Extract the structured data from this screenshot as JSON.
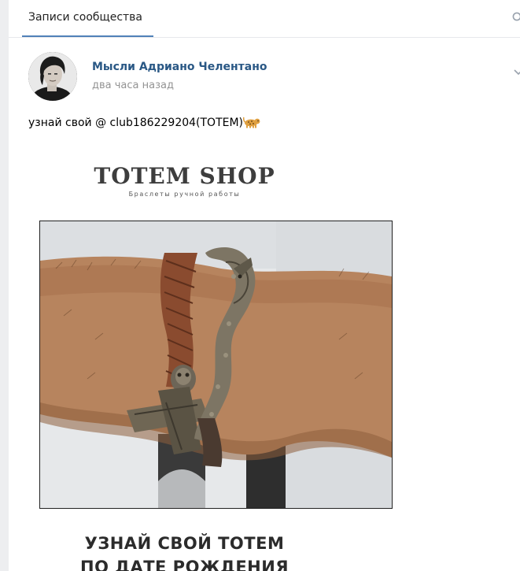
{
  "tabs": {
    "active_label": "Записи сообщества"
  },
  "post": {
    "author": "Мысли Адриано Челентано",
    "time": "два часа назад",
    "text": "узнай свой @ club186229204(TOTEM)",
    "emoji": "🐆"
  },
  "image": {
    "shop_title": "TOTEM SHOP",
    "shop_subtitle": "Браслеты ручной работы",
    "headline_line1": "УЗНАЙ СВОЙ ТОТЕМ",
    "headline_line2": "ПО ДАТЕ РОЖДЕНИЯ"
  },
  "colors": {
    "link": "#2a5885",
    "accent": "#5181b8",
    "muted": "#939393"
  },
  "icons": {
    "tab_search": "search-icon",
    "post_menu": "chevron-down-icon"
  }
}
